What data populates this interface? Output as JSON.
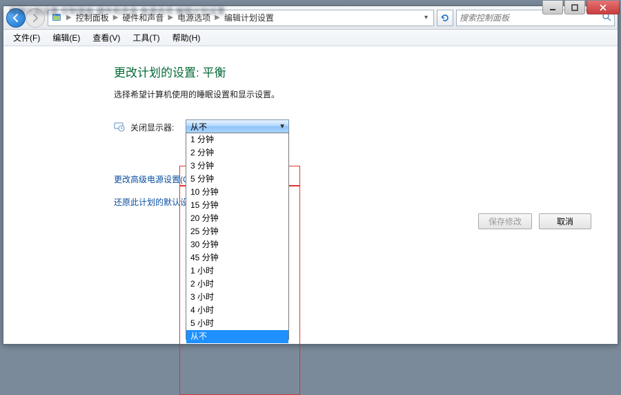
{
  "window": {
    "min_tip": "最小化",
    "max_tip": "最大化",
    "close_tip": "关闭"
  },
  "breadcrumb": {
    "items": [
      "控制面板",
      "硬件和声音",
      "电源选项",
      "编辑计划设置"
    ]
  },
  "search": {
    "placeholder": "搜索控制面板"
  },
  "menu": {
    "file": "文件(F)",
    "edit": "编辑(E)",
    "view": "查看(V)",
    "tools": "工具(T)",
    "help": "帮助(H)"
  },
  "page": {
    "title": "更改计划的设置: 平衡",
    "desc": "选择希望计算机使用的睡眠设置和显示设置。"
  },
  "setting": {
    "display_off_label": "关闭显示器:",
    "selected": "从不",
    "options": [
      "1 分钟",
      "2 分钟",
      "3 分钟",
      "5 分钟",
      "10 分钟",
      "15 分钟",
      "20 分钟",
      "25 分钟",
      "30 分钟",
      "45 分钟",
      "1 小时",
      "2 小时",
      "3 小时",
      "4 小时",
      "5 小时",
      "从不"
    ]
  },
  "links": {
    "advanced": "更改高级电源设置(C)",
    "restore": "还原此计划的默认设置(R)"
  },
  "buttons": {
    "save": "保存修改",
    "cancel": "取消"
  }
}
